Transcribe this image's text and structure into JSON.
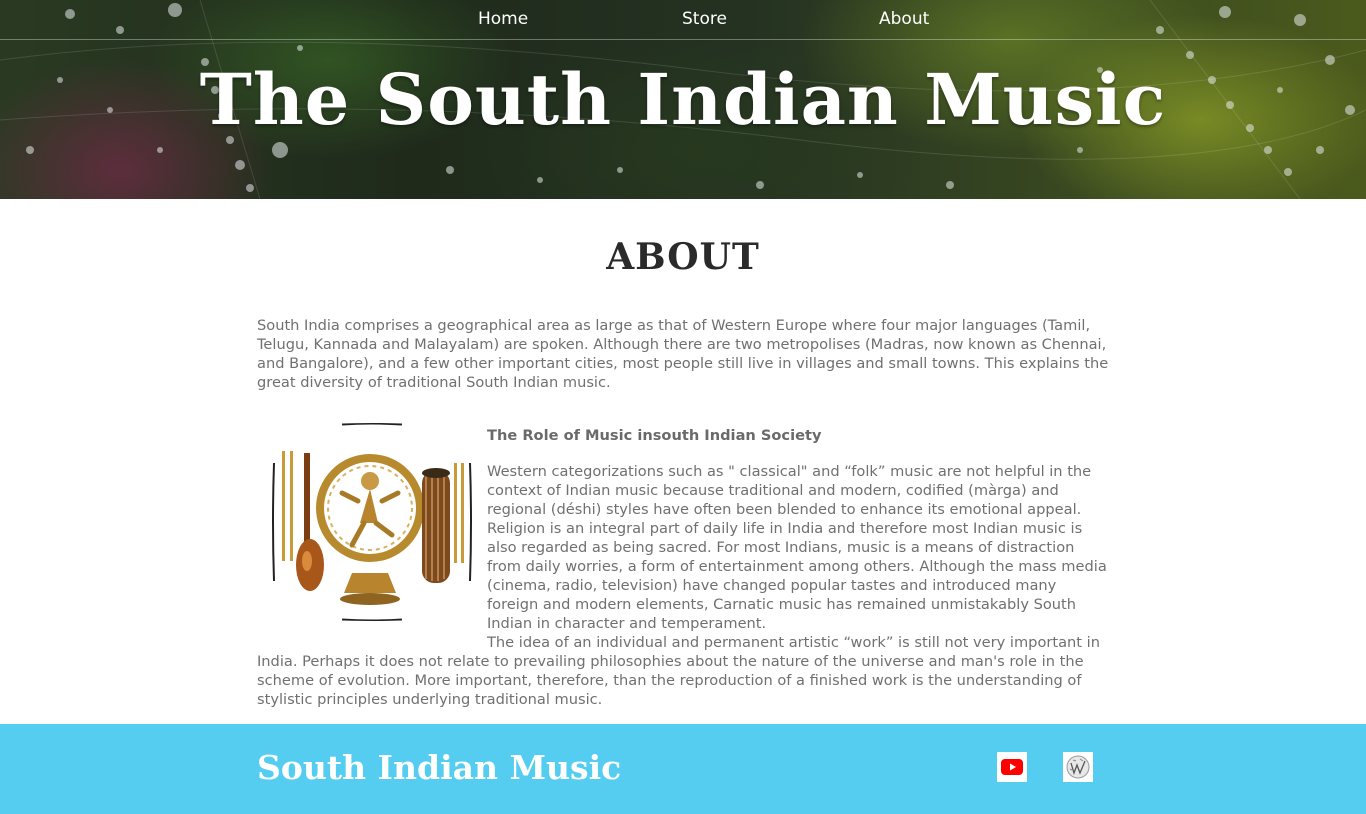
{
  "nav": {
    "items": [
      {
        "label": "Home"
      },
      {
        "label": "Store"
      },
      {
        "label": "About"
      }
    ]
  },
  "hero": {
    "title": "The South Indian Music"
  },
  "main": {
    "heading": "ABOUT",
    "intro": "South India comprises a geographical area as large as that of Western Europe where four major languages (Tamil, Telugu, Kannada and Malayalam) are spoken. Although there are two metropolises (Madras, now known as Chennai, and Bangalore), and a few other important cities, most people still live in villages and small towns. This explains the great diversity of traditional South Indian music.",
    "section_title": "The Role of Music insouth Indian Society",
    "paragraph1": "Western categorizations such as \" classical\" and “folk” music are not helpful in the context of Indian music because traditional and modern, codified (màrga) and regional (déshi) styles have often been blended to enhance its emotional appeal. Religion is an integral part of daily life in India and therefore most Indian music is also regarded as being sacred. For most Indians, music is a means of distraction from daily worries, a form of entertainment among others. Although the mass media (cinema, radio, television) have changed popular tastes and introduced many foreign and modern elements, Carnatic music has remained unmistakably South Indian in character and temperament.",
    "paragraph2": "The idea of an individual and permanent artistic “work” is still not very important in India. Perhaps it does not relate to prevailing philosophies about the nature of the universe and man's role in the scheme of evolution. More important, therefore, than the reproduction of a finished work is the understanding of stylistic principles underlying traditional music."
  },
  "footer": {
    "title": "South Indian Music",
    "icons": [
      "youtube-icon",
      "wikipedia-icon"
    ]
  },
  "colors": {
    "footer_bg": "#55cdf0",
    "text": "#707070",
    "heading": "#2a2a2a",
    "youtube_red": "#ff0000"
  }
}
